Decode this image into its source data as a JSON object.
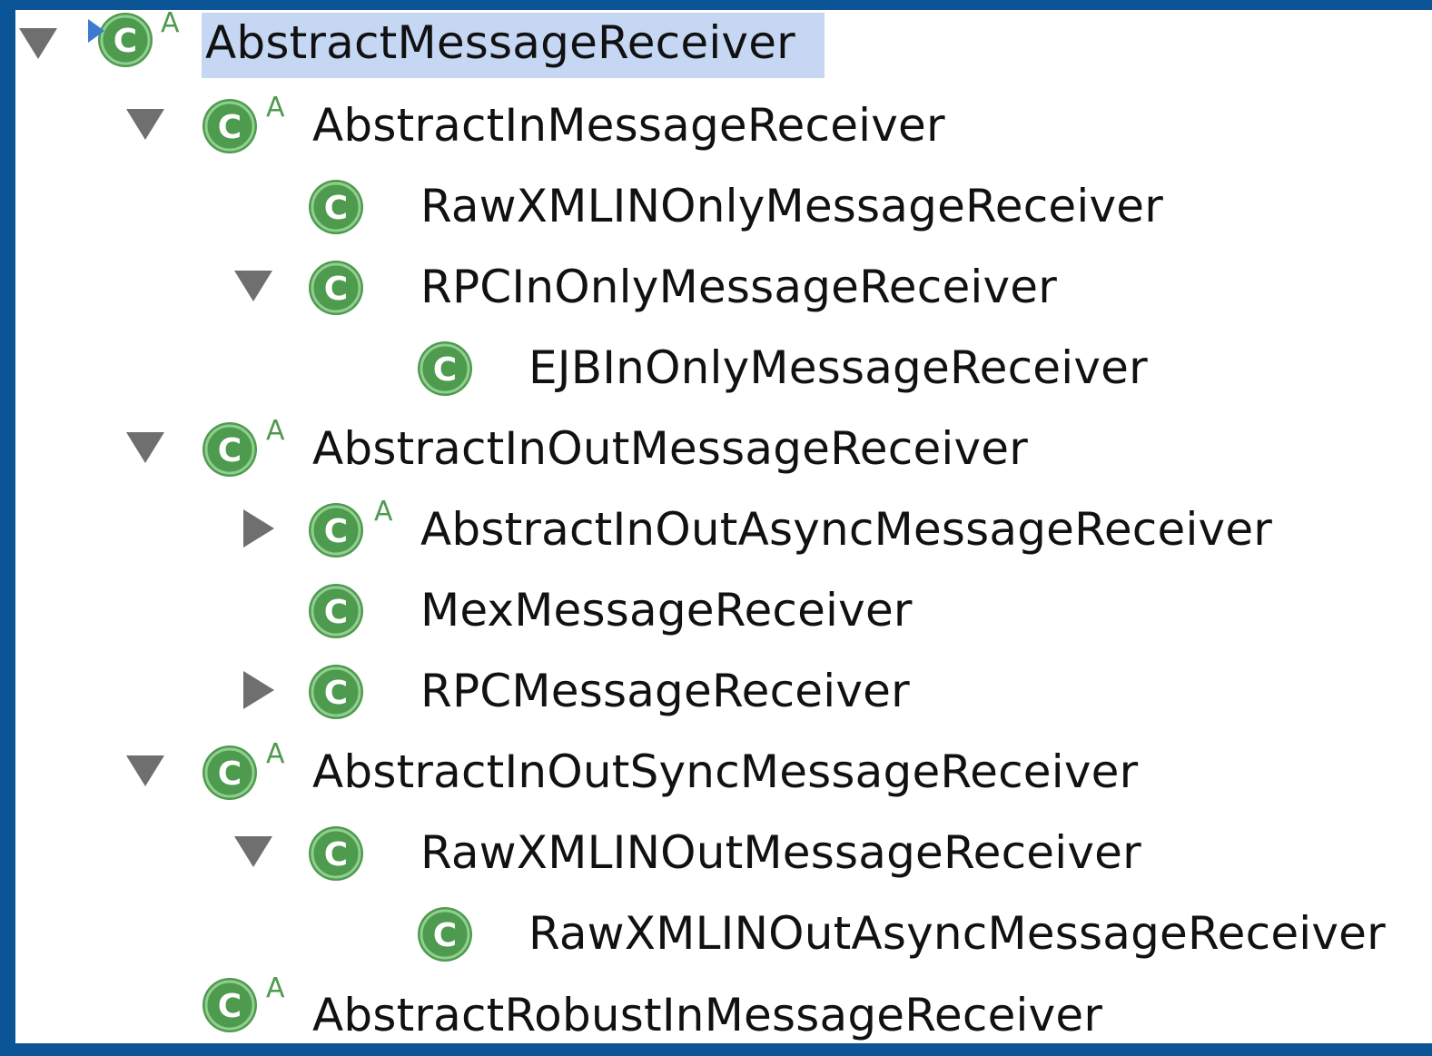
{
  "tree": {
    "items": [
      {
        "label": "AbstractMessageReceiver",
        "badge": "A",
        "state": "expanded",
        "selected": true
      },
      {
        "label": "AbstractInMessageReceiver",
        "badge": "A",
        "state": "expanded"
      },
      {
        "label": "RawXMLINOnlyMessageReceiver",
        "badge": "",
        "state": "leaf"
      },
      {
        "label": "RPCInOnlyMessageReceiver",
        "badge": "",
        "state": "expanded"
      },
      {
        "label": "EJBInOnlyMessageReceiver",
        "badge": "",
        "state": "leaf"
      },
      {
        "label": "AbstractInOutMessageReceiver",
        "badge": "A",
        "state": "expanded"
      },
      {
        "label": "AbstractInOutAsyncMessageReceiver",
        "badge": "A",
        "state": "collapsed"
      },
      {
        "label": "MexMessageReceiver",
        "badge": "",
        "state": "leaf"
      },
      {
        "label": "RPCMessageReceiver",
        "badge": "",
        "state": "collapsed"
      },
      {
        "label": "AbstractInOutSyncMessageReceiver",
        "badge": "A",
        "state": "expanded"
      },
      {
        "label": "RawXMLINOutMessageReceiver",
        "badge": "",
        "state": "expanded"
      },
      {
        "label": "RawXMLINOutAsyncMessageReceiver",
        "badge": "",
        "state": "leaf"
      },
      {
        "label": "AbstractRobustInMessageReceiver",
        "badge": "A",
        "state": "leaf"
      }
    ]
  },
  "colors": {
    "frame": "#0b5597",
    "selection": "#c5d7f3",
    "class_icon": "#4e9a4e",
    "twisty": "#6f6f6f"
  },
  "icons": {
    "class": "class-icon",
    "expanded": "expanded-triangle-icon",
    "collapsed": "collapsed-triangle-icon",
    "abstract": "abstract-badge"
  }
}
